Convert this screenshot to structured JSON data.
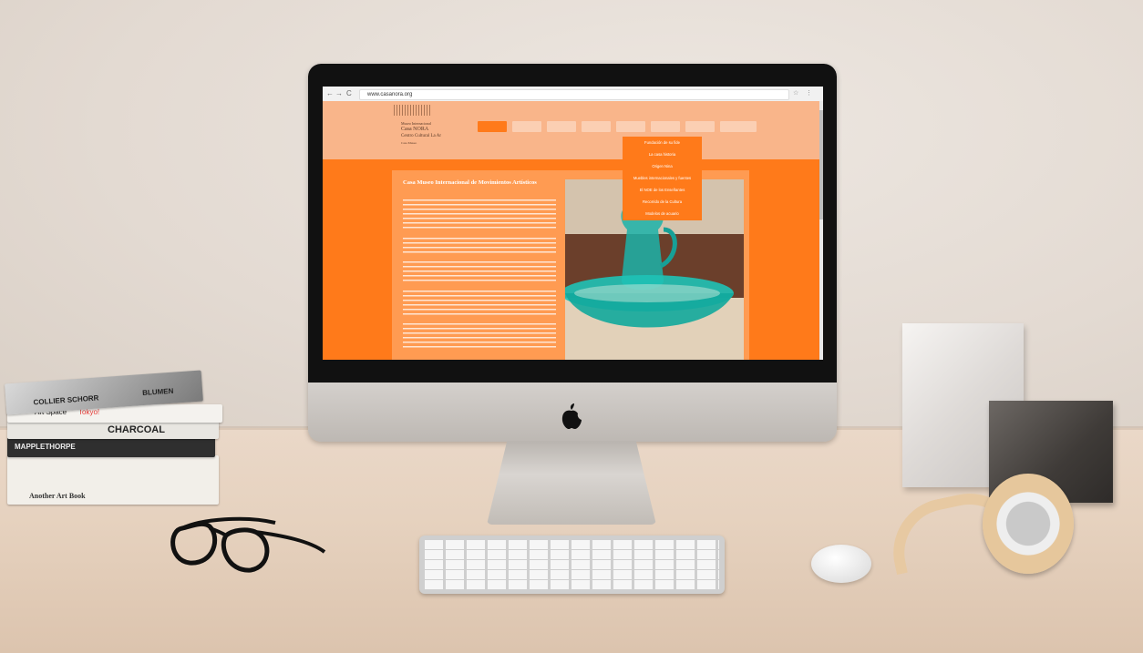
{
  "browser": {
    "url": "www.casanora.org",
    "back": "←",
    "forward": "→",
    "reload": "C"
  },
  "site": {
    "logo_lines": [
      "Museo Internacional",
      "Casa NORA",
      "Centro Cultural La Ar",
      "Casa Museo"
    ],
    "dropdown_items": [
      "Fundación de su fide",
      "La casa historia",
      "Origen Nina",
      "Muebles internacionales y fuentes",
      "El NOE de los Enseñantes",
      "Recorrido de la Cultura",
      "Modelos de acuario"
    ],
    "panel_title": "Casa Museo Internacional de Movimientos Artísticos"
  },
  "books": {
    "top_title": "BLUMEN",
    "collier": "COLLIER SCHORR",
    "art_space": "Art Space",
    "tokyo": "Tokyo!",
    "charcoal": "CHARCOAL",
    "mapple": "MAPPLETHORPE",
    "another": "Another Art Book"
  },
  "colors": {
    "site_orange": "#ff7a1a",
    "header_peach": "#f9b58a",
    "panel_orange": "#ff9b52"
  }
}
